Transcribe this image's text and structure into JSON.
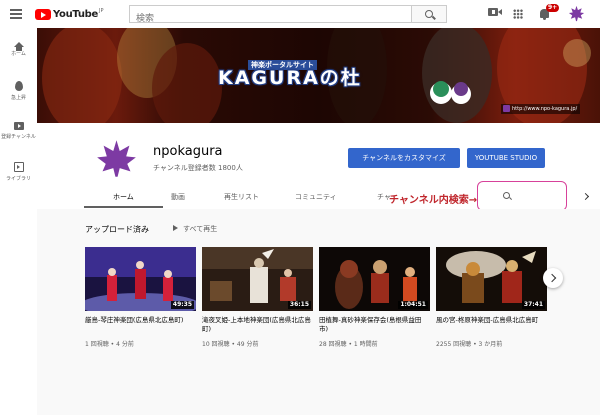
{
  "header": {
    "logo_text": "YouTube",
    "logo_region": "JP",
    "search_placeholder": "検索",
    "notification_count": "9+"
  },
  "sidebar": {
    "items": [
      {
        "label": "ホーム",
        "icon": "home-icon"
      },
      {
        "label": "急上昇",
        "icon": "trending-icon"
      },
      {
        "label": "登録チャンネル",
        "icon": "subscriptions-icon"
      },
      {
        "label": "ライブラリ",
        "icon": "library-icon"
      }
    ]
  },
  "banner": {
    "title_small": "神楽ポータルサイト",
    "title": "KAGURAの杜",
    "url": "http://www.npo-kagura.jp/"
  },
  "channel": {
    "name": "npokagura",
    "subscribers": "チャンネル登録者数 1800人",
    "customize_button": "チャンネルをカスタマイズ",
    "studio_button": "YOUTUBE STUDIO",
    "tabs": [
      "ホーム",
      "動画",
      "再生リスト",
      "コミュニティ",
      "チャ"
    ],
    "active_tab": "ホーム",
    "annotation": "チャンネル内検索→",
    "brand_color": "#7d3aa3",
    "accent_color": "#3366cc"
  },
  "uploads": {
    "section_title": "アップロード済み",
    "play_all": "すべて再生",
    "videos": [
      {
        "title": "厳島-琴庄神楽団(広島県北広島町)",
        "duration": "49:35",
        "views": "1 回視聴",
        "age": "4 分前"
      },
      {
        "title": "滝夜叉姫-上本地神楽団(広島県北広島町)",
        "duration": "36:15",
        "views": "10 回視聴",
        "age": "49 分前"
      },
      {
        "title": "田植舞-真砂神楽保存会(島根県益田市)",
        "duration": "1:04:51",
        "views": "28 回視聴",
        "age": "1 時間前"
      },
      {
        "title": "風の宮-柊原神楽団-広島県北広島町",
        "duration": "37:41",
        "views": "2255 回視聴",
        "age": "3 か月前"
      }
    ]
  }
}
